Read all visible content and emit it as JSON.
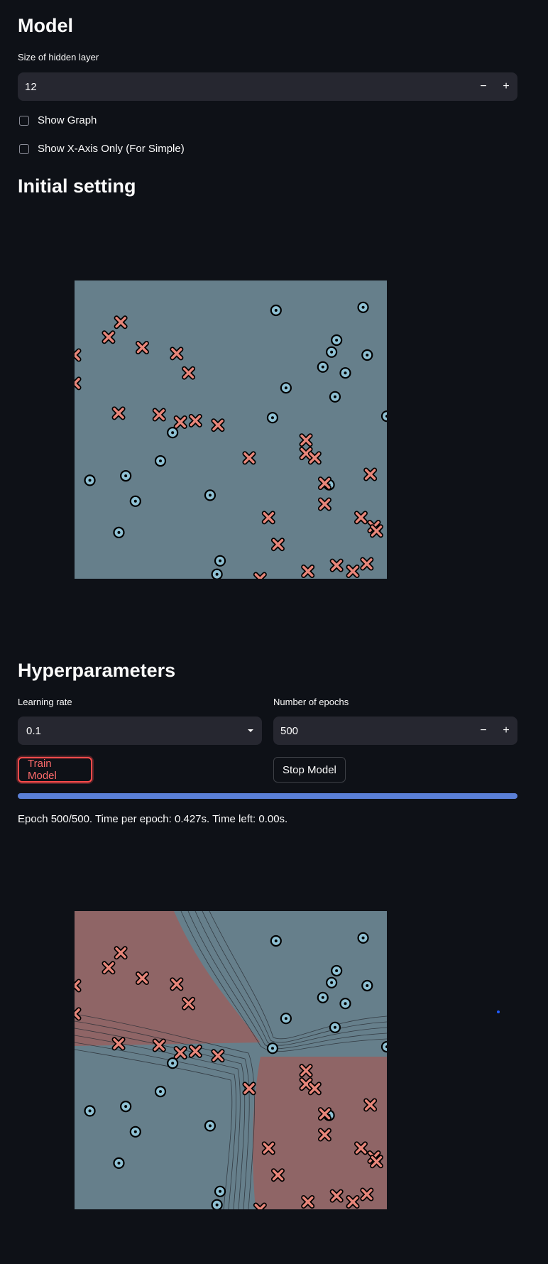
{
  "model": {
    "heading": "Model",
    "hidden_size_label": "Size of hidden layer",
    "hidden_size_value": "12",
    "minus_label": "−",
    "plus_label": "+",
    "show_graph_label": "Show Graph",
    "show_xaxis_label": "Show X-Axis Only (For Simple)"
  },
  "initial": {
    "heading": "Initial setting"
  },
  "hyper": {
    "heading": "Hyperparameters",
    "lr_label": "Learning rate",
    "lr_value": "0.1",
    "epochs_label": "Number of epochs",
    "epochs_value": "500",
    "train_label": "Train Model",
    "stop_label": "Stop Model",
    "progress": 1.0,
    "status": "Epoch 500/500. Time per epoch: 0.427s. Time left: 0.00s."
  },
  "colors": {
    "background": "#0e1117",
    "blue_region": "#667f8b",
    "red_region": "#8f6566",
    "circle_fill": "#8fc1d4",
    "cross_fill": "#e8867a",
    "accent": "#ff4b4b",
    "progress": "#5a7fd6"
  },
  "chart_data": {
    "type": "scatter",
    "title": "",
    "xlim": [
      0,
      1
    ],
    "ylim": [
      0,
      1
    ],
    "series": [
      {
        "marker": "circle",
        "points": [
          [
            0.645,
            0.9
          ],
          [
            0.924,
            0.91
          ],
          [
            0.839,
            0.8
          ],
          [
            0.823,
            0.76
          ],
          [
            0.795,
            0.71
          ],
          [
            0.867,
            0.69
          ],
          [
            0.937,
            0.75
          ],
          [
            0.677,
            0.64
          ],
          [
            0.834,
            0.61
          ],
          [
            0.634,
            0.54
          ],
          [
            1.0,
            0.545
          ],
          [
            0.314,
            0.49
          ],
          [
            0.275,
            0.395
          ],
          [
            0.049,
            0.33
          ],
          [
            0.164,
            0.345
          ],
          [
            0.195,
            0.26
          ],
          [
            0.434,
            0.28
          ],
          [
            0.142,
            0.155
          ],
          [
            0.466,
            0.06
          ],
          [
            0.456,
            0.015
          ],
          [
            0.815,
            0.315
          ]
        ]
      },
      {
        "marker": "cross",
        "points": [
          [
            0.148,
            0.86
          ],
          [
            0.109,
            0.81
          ],
          [
            0.217,
            0.775
          ],
          [
            0.0,
            0.75
          ],
          [
            0.327,
            0.755
          ],
          [
            0.365,
            0.69
          ],
          [
            0.0,
            0.655
          ],
          [
            0.141,
            0.555
          ],
          [
            0.271,
            0.55
          ],
          [
            0.339,
            0.525
          ],
          [
            0.387,
            0.53
          ],
          [
            0.459,
            0.515
          ],
          [
            0.741,
            0.465
          ],
          [
            0.741,
            0.42
          ],
          [
            0.769,
            0.405
          ],
          [
            0.559,
            0.405
          ],
          [
            0.947,
            0.35
          ],
          [
            0.801,
            0.32
          ],
          [
            0.801,
            0.25
          ],
          [
            0.621,
            0.205
          ],
          [
            0.917,
            0.205
          ],
          [
            0.959,
            0.175
          ],
          [
            0.967,
            0.16
          ],
          [
            0.651,
            0.115
          ],
          [
            0.839,
            0.045
          ],
          [
            0.936,
            0.05
          ],
          [
            0.747,
            0.025
          ],
          [
            0.594,
            0.0
          ],
          [
            0.891,
            0.025
          ]
        ]
      }
    ]
  }
}
